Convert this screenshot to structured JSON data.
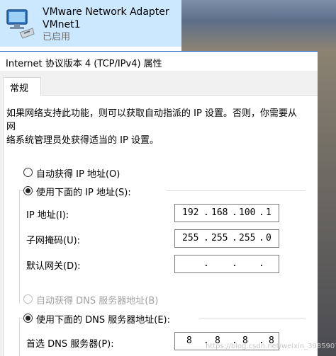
{
  "adapter": {
    "name_line1": "VMware Network Adapter",
    "name_line2": "VMnet1",
    "status": "已启用"
  },
  "dialog": {
    "title": "Internet 协议版本 4 (TCP/IPv4) 属性",
    "tab_general": "常规",
    "description_line1": "如果网络支持此功能，则可以获取自动指派的 IP 设置。否则，你需要从网",
    "description_line2": "络系统管理员处获得适当的 IP 设置。",
    "ip_section": {
      "auto_label": "自动获得 IP 地址(O)",
      "manual_label": "使用下面的 IP 地址(S):",
      "ip_label": "IP 地址(I):",
      "ip_value": [
        "192",
        "168",
        "100",
        "1"
      ],
      "mask_label": "子网掩码(U):",
      "mask_value": [
        "255",
        "255",
        "255",
        "0"
      ],
      "gateway_label": "默认网关(D):",
      "gateway_value": [
        "",
        "",
        "",
        ""
      ]
    },
    "dns_section": {
      "auto_label": "自动获得 DNS 服务器地址(B)",
      "manual_label": "使用下面的 DNS 服务器地址(E):",
      "preferred_label": "首选 DNS 服务器(P):",
      "preferred_value": [
        "8",
        "8",
        "8",
        "8"
      ]
    }
  },
  "watermark": "https://blog.csdn.net/weixin_3985907"
}
